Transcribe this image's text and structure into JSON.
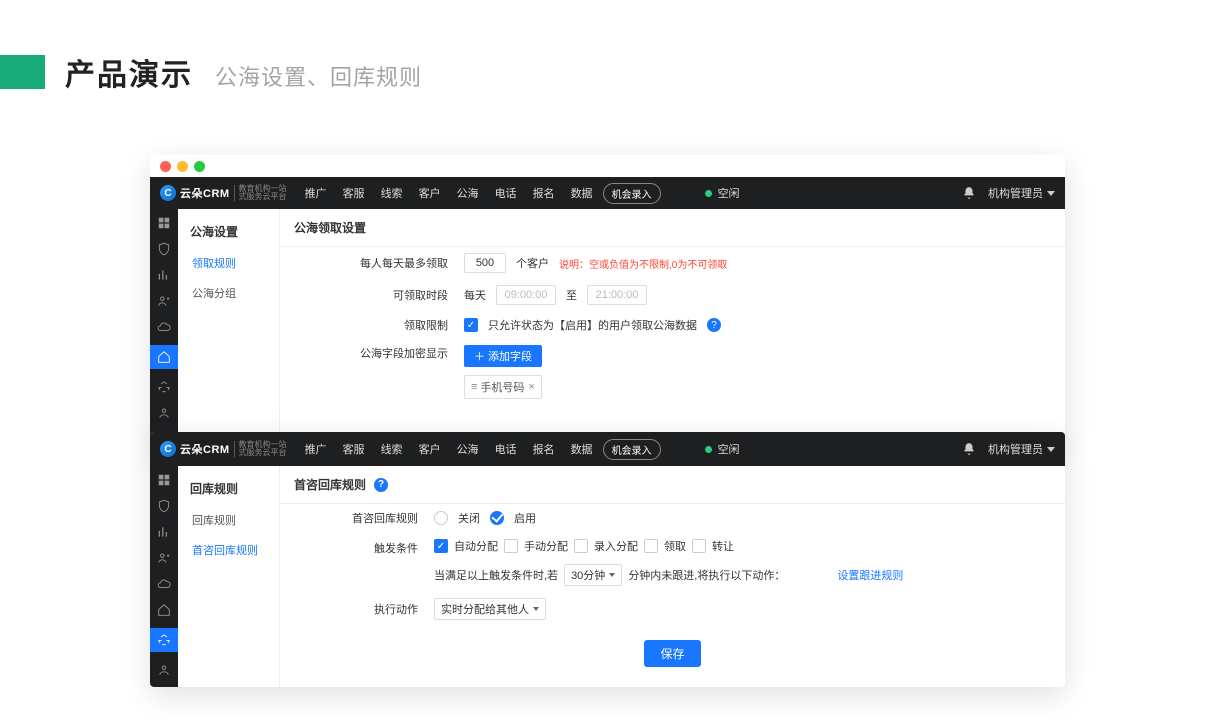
{
  "slide": {
    "title": "产品演示",
    "subtitle": "公海设置、回库规则"
  },
  "logo": {
    "brand": "云朵CRM",
    "tag1": "教育机构一站",
    "tag2": "式服务云平台"
  },
  "nav": {
    "items": [
      "推广",
      "客服",
      "线索",
      "客户",
      "公海",
      "电话",
      "报名",
      "数据"
    ],
    "pill": "机会录入",
    "status": "空闲",
    "user": "机构管理员"
  },
  "win1": {
    "side_title": "公海设置",
    "side_items": [
      "领取规则",
      "公海分组"
    ],
    "side_active": 0,
    "section": "公海领取设置",
    "row1_label": "每人每天最多领取",
    "row1_value": "500",
    "row1_suffix": "个客户",
    "row1_note_prefix": "说明：",
    "row1_note": "空或负值为不限制,0为不可领取",
    "row2_label": "可领取时段",
    "row2_daily": "每天",
    "row2_from": "09:00:00",
    "row2_to_label": "至",
    "row2_to": "21:00:00",
    "row3_label": "领取限制",
    "row3_text": "只允许状态为【启用】的用户领取公海数据",
    "row4_label": "公海字段加密显示",
    "row4_btn": "添加字段",
    "row4_tag": "手机号码"
  },
  "win2": {
    "side_title": "回库规则",
    "side_items": [
      "回库规则",
      "首咨回库规则"
    ],
    "side_active": 1,
    "section": "首咨回库规则",
    "row1_label": "首咨回库规则",
    "row1_off": "关闭",
    "row1_on": "启用",
    "row2_label": "触发条件",
    "row2_opts": [
      "自动分配",
      "手动分配",
      "录入分配",
      "领取",
      "转让"
    ],
    "row2_checked": [
      true,
      false,
      false,
      false,
      false
    ],
    "cond_prefix": "当满足以上触发条件时,若",
    "cond_mins": "30分钟",
    "cond_mid": "分钟内未跟进,将执行以下动作：",
    "cond_link": "设置跟进规则",
    "row3_label": "执行动作",
    "row3_select": "实时分配给其他人",
    "save": "保存"
  }
}
